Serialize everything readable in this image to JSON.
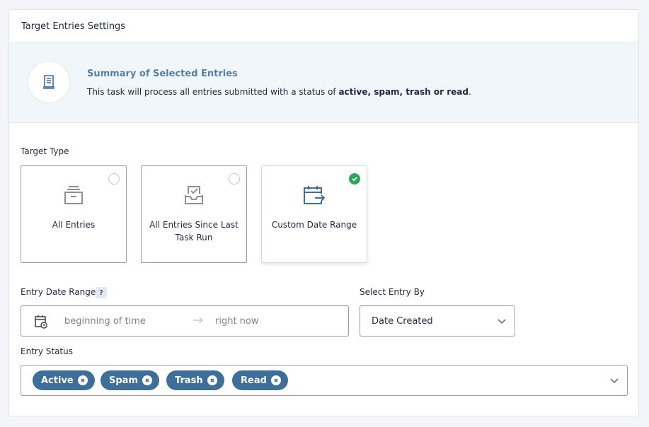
{
  "panel": {
    "title": "Target Entries Settings"
  },
  "summary": {
    "icon": "document-icon",
    "title": "Summary of Selected Entries",
    "text_prefix": "This task will process all entries submitted with a status of ",
    "text_bold": "active, spam, trash or read",
    "text_suffix": "."
  },
  "target_type": {
    "label": "Target Type",
    "options": [
      {
        "label": "All Entries",
        "icon": "archive-box-icon",
        "selected": false
      },
      {
        "label": "All Entries Since Last Task Run",
        "icon": "inbox-check-icon",
        "selected": false
      },
      {
        "label": "Custom Date Range",
        "icon": "calendar-arrow-icon",
        "selected": true
      }
    ]
  },
  "date_range": {
    "label": "Entry Date Range",
    "help": "?",
    "start_placeholder": "beginning of time",
    "end_placeholder": "right now"
  },
  "select_by": {
    "label": "Select Entry By",
    "value": "Date Created"
  },
  "entry_status": {
    "label": "Entry Status",
    "tags": [
      "Active",
      "Spam",
      "Trash",
      "Read"
    ]
  },
  "colors": {
    "accent": "#3e6f9a",
    "check": "#2aa85a",
    "summary_bg": "#f1f6fa",
    "title_blue": "#5a7fa5"
  }
}
